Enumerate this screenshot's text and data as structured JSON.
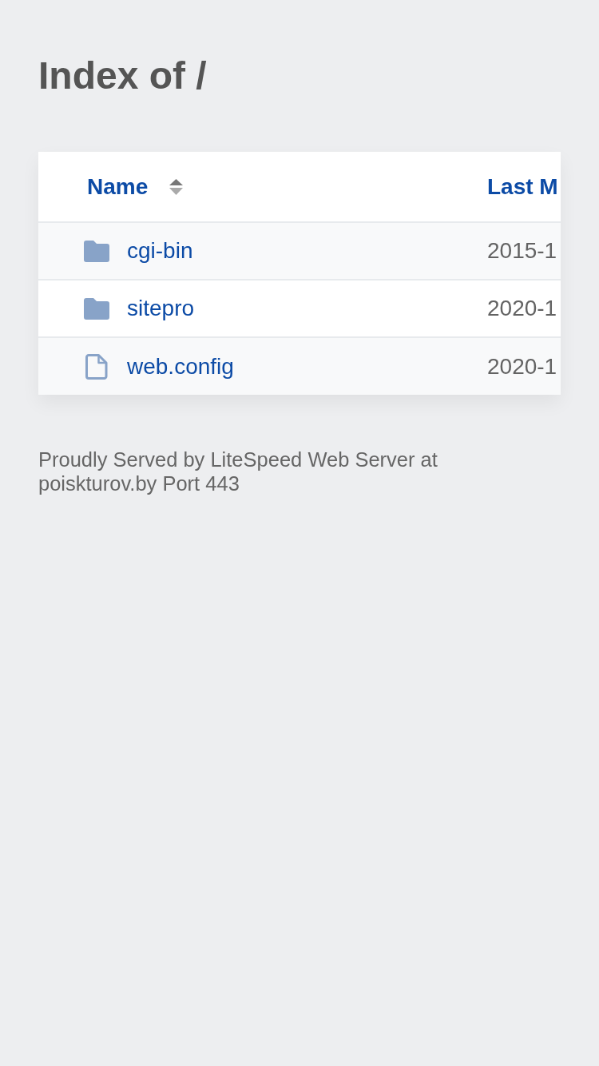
{
  "page": {
    "title": "Index of /"
  },
  "table": {
    "columns": [
      {
        "label": "Name",
        "sortable": true
      },
      {
        "label": "Last M"
      }
    ],
    "rows": [
      {
        "kind": "folder",
        "name": "cgi-bin",
        "column_2": "2015-1"
      },
      {
        "kind": "folder",
        "name": "sitepro",
        "column_2": "2020-1"
      },
      {
        "kind": "file",
        "name": "web.config",
        "column_2": "2020-1"
      }
    ]
  },
  "footer": {
    "text": "Proudly Served by LiteSpeed Web Server at poiskturov.by Port 443"
  }
}
